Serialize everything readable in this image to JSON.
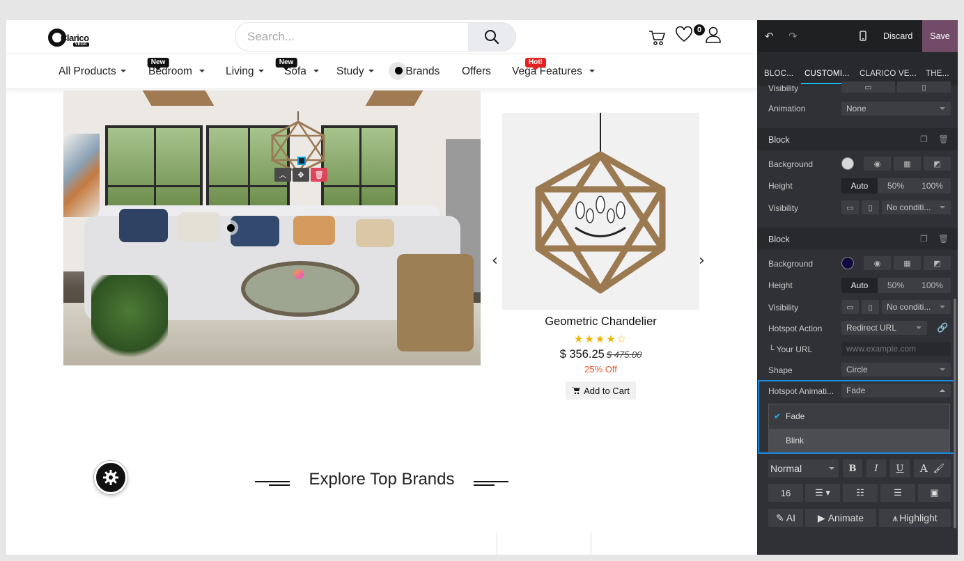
{
  "site": {
    "search": {
      "placeholder": "Search..."
    },
    "cart_count": "0",
    "logo": {
      "brand": "Clarico",
      "sub": "VEGA"
    },
    "nav": [
      {
        "label": "All Products",
        "dropdown": true
      },
      {
        "label": "Bedroom",
        "dropdown": true,
        "badge": "New"
      },
      {
        "label": "Living",
        "dropdown": true
      },
      {
        "label": "Sofa",
        "dropdown": true,
        "badge": "New"
      },
      {
        "label": "Study",
        "dropdown": true
      },
      {
        "label": "Brands",
        "dropdown": false
      },
      {
        "label": "Offers",
        "dropdown": false
      },
      {
        "label": "Vega Features",
        "dropdown": true,
        "badge": "Hot!"
      }
    ],
    "product": {
      "name": "Geometric Chandelier",
      "rating": 4,
      "rating_max": 5,
      "price": "$ 356.25",
      "old_price": "$ 475.00",
      "discount": "25% Off",
      "add_to_cart": "Add to Cart"
    },
    "brands_title": "Explore Top Brands"
  },
  "panel": {
    "discard": "Discard",
    "save": "Save",
    "tabs": [
      "BLOC...",
      "CUSTOMI...",
      "CLARICO VE...",
      "THE..."
    ],
    "active_tab": 1,
    "top_rows": {
      "visibility": "Visibility",
      "animation": "Animation",
      "animation_value": "None"
    },
    "block1": {
      "title": "Block",
      "background": "Background",
      "background_color": "#d9d9d9",
      "height": "Height",
      "height_options": [
        "Auto",
        "50%",
        "100%"
      ],
      "visibility": "Visibility",
      "visibility_value": "No conditi..."
    },
    "block2": {
      "title": "Block",
      "background": "Background",
      "background_color": "#0d0b3f",
      "height": "Height",
      "height_options": [
        "Auto",
        "50%",
        "100%"
      ],
      "visibility": "Visibility",
      "visibility_value": "No conditi...",
      "hotspot_action": "Hotspot Action",
      "hotspot_action_value": "Redirect URL",
      "your_url": "└ Your URL",
      "url_placeholder": "www.example.com",
      "shape": "Shape",
      "shape_value": "Circle",
      "hotspot_animation": "Hotspot Animati...",
      "hotspot_animation_value": "Fade",
      "animation_options": [
        "Fade",
        "Blink"
      ]
    },
    "text_tools": {
      "style": "Normal",
      "bold": "B",
      "italic": "I",
      "underline": "U",
      "font_size": "16",
      "ai": "AI",
      "animate": "Animate",
      "highlight": "Highlight"
    }
  }
}
